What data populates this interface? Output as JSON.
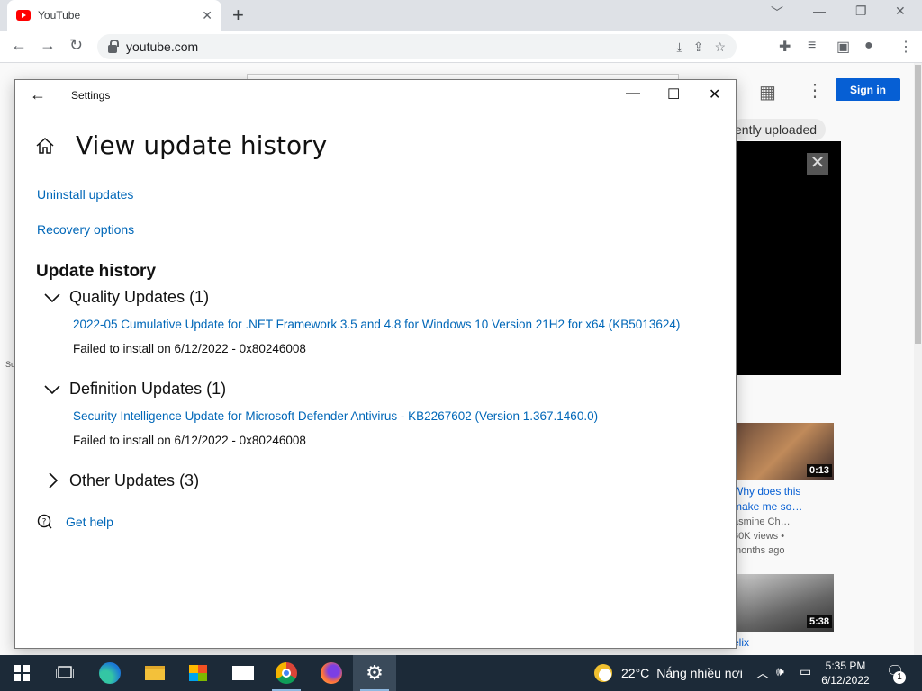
{
  "browser": {
    "tab_title": "YouTube",
    "tab_close": "✕",
    "new_tab": "+",
    "url": "youtube.com"
  },
  "youtube": {
    "signin_label": "Sign in",
    "chip_label": "ently uploaded",
    "side_text": "Su",
    "videos": [
      {
        "duration": "0:13",
        "title": "Why does this",
        "title2": "make me so…",
        "channel": "asmine Ch…",
        "views": "60K views •",
        "age": "months ago"
      },
      {
        "duration": "5:38",
        "title": "elix"
      }
    ]
  },
  "settings": {
    "window_title": "Settings",
    "page_title": "View update history",
    "links": {
      "uninstall": "Uninstall updates",
      "recovery": "Recovery options"
    },
    "section_title": "Update history",
    "groups": [
      {
        "label": "Quality Updates (1)",
        "expanded": true,
        "item_title": "2022-05 Cumulative Update for .NET Framework 3.5 and 4.8 for Windows 10 Version 21H2 for x64 (KB5013624)",
        "item_status": "Failed to install on 6/12/2022 - 0x80246008"
      },
      {
        "label": "Definition Updates (1)",
        "expanded": true,
        "item_title": "Security Intelligence Update for Microsoft Defender Antivirus - KB2267602 (Version 1.367.1460.0)",
        "item_status": "Failed to install on 6/12/2022 - 0x80246008"
      },
      {
        "label": "Other Updates (3)",
        "expanded": false
      }
    ],
    "help_label": "Get help"
  },
  "taskbar": {
    "weather_temp": "22°C",
    "weather_text": "Nắng nhiều nơi",
    "time": "5:35 PM",
    "date": "6/12/2022",
    "notification_count": "1"
  },
  "colors": {
    "link": "#0067b8",
    "signin": "#065fd4",
    "taskbar": "#1c2a38"
  }
}
